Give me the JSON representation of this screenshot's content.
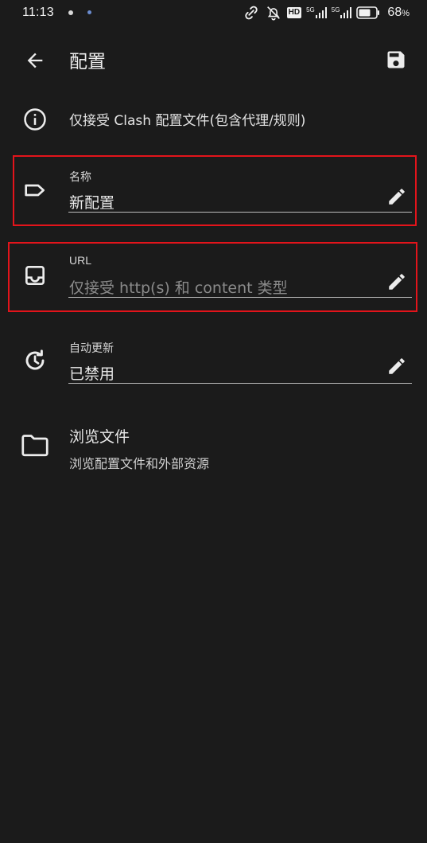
{
  "status_bar": {
    "time": "11:13",
    "hd_badge": "HD",
    "signal_1": "5G",
    "signal_2": "5G",
    "battery_level": "68",
    "battery_unit": "%"
  },
  "app_bar": {
    "title": "配置",
    "back_icon": "arrow-back-icon",
    "save_icon": "save-icon"
  },
  "info": {
    "icon": "info-icon",
    "text": "仅接受 Clash 配置文件(包含代理/规则)"
  },
  "fields": [
    {
      "icon": "label-tag-icon",
      "label": "名称",
      "value": "新配置",
      "is_placeholder": false
    },
    {
      "icon": "inbox-tray-icon",
      "label": "URL",
      "value": "仅接受 http(s) 和 content 类型",
      "is_placeholder": true
    },
    {
      "icon": "history-clock-icon",
      "label": "自动更新",
      "value": "已禁用",
      "is_placeholder": false
    }
  ],
  "browse": {
    "icon": "folder-icon",
    "title": "浏览文件",
    "subtitle": "浏览配置文件和外部资源"
  },
  "colors": {
    "background": "#1b1b1b",
    "text": "#e8e8e8",
    "placeholder": "#8a8a8a",
    "highlight_border": "#e3141b"
  }
}
